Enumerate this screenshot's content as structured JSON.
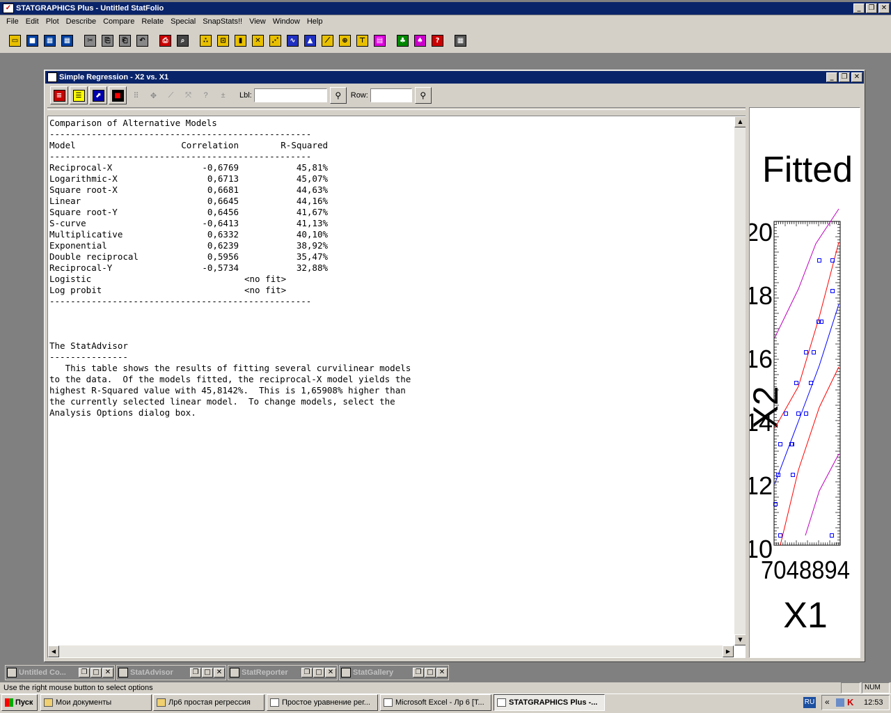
{
  "app": {
    "title": "STATGRAPHICS Plus - Untitled StatFolio",
    "menu": [
      "File",
      "Edit",
      "Plot",
      "Describe",
      "Compare",
      "Relate",
      "Special",
      "SnapStats!!",
      "View",
      "Window",
      "Help"
    ]
  },
  "toolbar": {
    "icons": [
      "open-icon",
      "save-icon",
      "data-grid-icon",
      "numeric-data-icon",
      "cut-icon",
      "copy-icon",
      "paste-icon",
      "undo-icon",
      "print-icon",
      "print-preview-icon",
      "scatterplot-icon",
      "box-icon",
      "barchart-icon",
      "multi-scatter-icon",
      "plot-icon",
      "timeseries-icon",
      "distribution-icon",
      "line-chart-icon",
      "globe-icon",
      "tree-icon",
      "glm-icon",
      "statadvisor-icon",
      "wizard-icon",
      "help-icon",
      "calculator-icon"
    ]
  },
  "analysis_window": {
    "title": "Simple Regression - X2 vs. X1",
    "lbl_label": "Lbl:",
    "row_label": "Row:",
    "lbl_value": "",
    "row_value": ""
  },
  "report": {
    "heading": "Comparison of Alternative Models",
    "divider": "--------------------------------------------------",
    "col_model": "Model",
    "col_corr": "Correlation",
    "col_r2": "R-Squared",
    "rows": [
      {
        "model": "Reciprocal-X",
        "corr": "-0,6769",
        "r2": "45,81%"
      },
      {
        "model": "Logarithmic-X",
        "corr": "0,6713",
        "r2": "45,07%"
      },
      {
        "model": "Square root-X",
        "corr": "0,6681",
        "r2": "44,63%"
      },
      {
        "model": "Linear",
        "corr": "0,6645",
        "r2": "44,16%"
      },
      {
        "model": "Square root-Y",
        "corr": "0,6456",
        "r2": "41,67%"
      },
      {
        "model": "S-curve",
        "corr": "-0,6413",
        "r2": "41,13%"
      },
      {
        "model": "Multiplicative",
        "corr": "0,6332",
        "r2": "40,10%"
      },
      {
        "model": "Exponential",
        "corr": "0,6239",
        "r2": "38,92%"
      },
      {
        "model": "Double reciprocal",
        "corr": "0,5956",
        "r2": "35,47%"
      },
      {
        "model": "Reciprocal-Y",
        "corr": "-0,5734",
        "r2": "32,88%"
      }
    ],
    "nofit_rows": [
      {
        "model": "Logistic",
        "text": "<no fit>"
      },
      {
        "model": "Log probit",
        "text": "<no fit>"
      }
    ],
    "advisor_title": "The StatAdvisor",
    "advisor_underline": "---------------",
    "advisor_text": "   This table shows the results of fitting several curvilinear models\nto the data.  Of the models fitted, the reciprocal-X model yields the\nhighest R-Squared value with 45,8142%.  This is 1,65908% higher than\nthe currently selected linear model.  To change models, select the\nAnalysis Options dialog box."
  },
  "chart_data": {
    "type": "scatter",
    "title": "Fitted",
    "xlabel": "X1",
    "ylabel": "X2",
    "ytick_labels": [
      "20",
      "18",
      "16",
      "14",
      "12",
      "10"
    ],
    "xtick_text": "7048894",
    "colors": {
      "points": "#0000ff",
      "fit": "#0000ff",
      "confidence": "#ff0000",
      "prediction": "#c000c0"
    }
  },
  "minimized": [
    {
      "label": "Untitled Co..."
    },
    {
      "label": "StatAdvisor"
    },
    {
      "label": "StatReporter"
    },
    {
      "label": "StatGallery"
    }
  ],
  "status": {
    "hint": "Use the right mouse button to select options",
    "num": "NUM"
  },
  "taskbar": {
    "start": "Пуск",
    "buttons": [
      "Мои документы",
      "Лр6 простая регрессия",
      "Простое уравнение рег...",
      "Microsoft Excel - Лр 6  [Т...",
      "STATGRAPHICS Plus -..."
    ],
    "lang": "RU",
    "clock": "12:53"
  }
}
